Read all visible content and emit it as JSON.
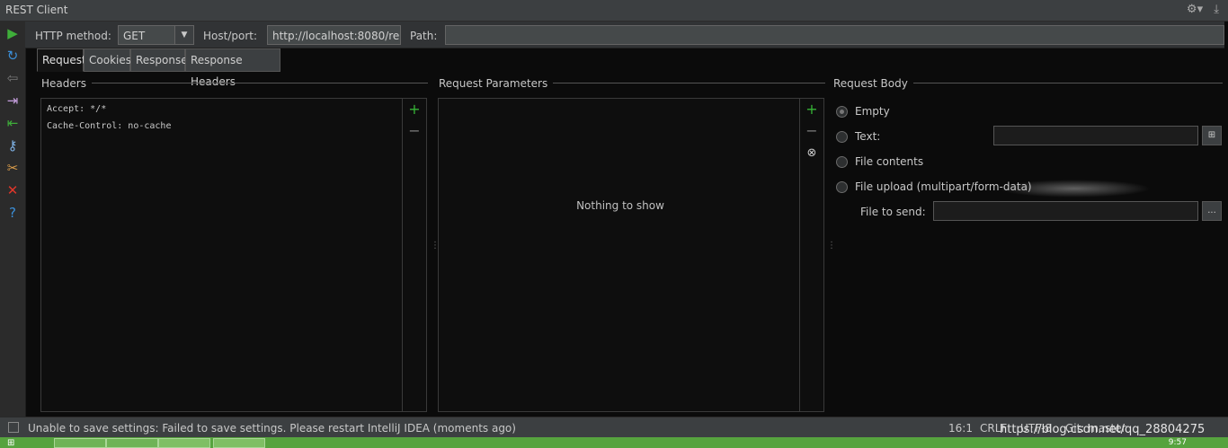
{
  "window": {
    "title": "REST Client"
  },
  "toolbar": {
    "method_label": "HTTP method:",
    "method_value": "GET",
    "host_label": "Host/port:",
    "host_value": "http://localhost:8080/re",
    "path_label": "Path:",
    "path_value": ""
  },
  "tabs": [
    {
      "label": "Request",
      "active": true
    },
    {
      "label": "Cookies",
      "active": false
    },
    {
      "label": "Response",
      "active": false
    },
    {
      "label": "Response Headers",
      "active": false
    }
  ],
  "headers": {
    "title": "Headers",
    "rows": [
      "Accept: */*",
      "Cache-Control: no-cache"
    ]
  },
  "params": {
    "title": "Request Parameters",
    "empty_text": "Nothing to show"
  },
  "body": {
    "title": "Request Body",
    "options": [
      {
        "label": "Empty",
        "selected": true
      },
      {
        "label": "Text:",
        "selected": false
      },
      {
        "label": "File contents",
        "selected": false
      },
      {
        "label": "File upload (multipart/form-data)",
        "selected": false
      }
    ],
    "file_to_send_label": "File to send:",
    "browse_label": "..."
  },
  "status": {
    "message": "Unable to save settings: Failed to save settings. Please restart IntelliJ IDEA (moments ago)",
    "position": "16:1",
    "line_sep": "CRLF",
    "encoding": "UTF-8",
    "git": "Git: master"
  },
  "watermark": "https://blog.csdn.net/qq_28804275",
  "taskbar": {
    "clock": "9:57"
  },
  "colors": {
    "run_green": "#3fae3a",
    "add_green": "#36b336",
    "remove_red": "#e0362a",
    "help_blue": "#3b8fd8"
  }
}
